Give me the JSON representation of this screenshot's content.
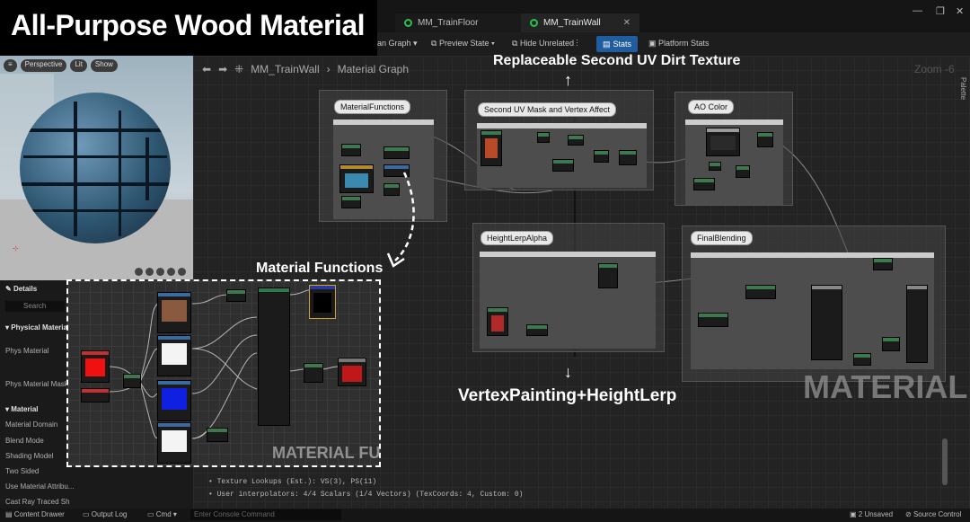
{
  "banner": {
    "title": "All-Purpose Wood Material"
  },
  "tabs": [
    {
      "label": "MM_TrainFloor"
    },
    {
      "label": "MM_TrainWall"
    }
  ],
  "toolbar": {
    "main_graph": "an Graph",
    "preview_state": "Preview State",
    "hide_unrelated": "Hide Unrelated",
    "stats": "Stats",
    "platform_stats": "Platform Stats"
  },
  "viewport": {
    "perspective": "Perspective",
    "lit": "Lit",
    "show": "Show"
  },
  "breadcrumb": {
    "asset": "MM_TrainWall",
    "sep": "›",
    "graph": "Material Graph"
  },
  "graph": {
    "zoom": "Zoom -6",
    "palette": "Palette"
  },
  "details": {
    "tab": "Details",
    "search_placeholder": "Search",
    "sections": [
      "Physical Material",
      "Material"
    ],
    "rows": [
      "Phys Material",
      "Phys Material Mask",
      "Material Domain",
      "Blend Mode",
      "Shading Model",
      "Two Sided",
      "Use Material Attribu...",
      "Cast Ray Traced Sh"
    ]
  },
  "comments": [
    {
      "label": "MaterialFunctions"
    },
    {
      "label": "Second UV Mask and Vertex Affect"
    },
    {
      "label": "AO Color"
    },
    {
      "label": "HeightLerpAlpha"
    },
    {
      "label": "FinalBlending"
    }
  ],
  "annotations": {
    "uv_dirt": "Replaceable Second UV Dirt Texture",
    "material_functions": "Material Functions",
    "vertex_painting": "VertexPainting+HeightLerp",
    "arrow_up": "↑",
    "arrow_down": "↓"
  },
  "watermarks": {
    "material": "MATERIAL",
    "material_fu": "MATERIAL FU"
  },
  "stats": {
    "line1": "• Texture Lookups (Est.): VS(3), PS(11)",
    "line2": "• User interpolators: 4/4 Scalars (1/4 Vectors) (TexCoords: 4, Custom: 0)"
  },
  "bottom": {
    "content_drawer": "Content Drawer",
    "output_log": "Output Log",
    "cmd": "Cmd",
    "console_placeholder": "Enter Console Command",
    "unsaved": "2 Unsaved",
    "source_control": "Source Control"
  }
}
